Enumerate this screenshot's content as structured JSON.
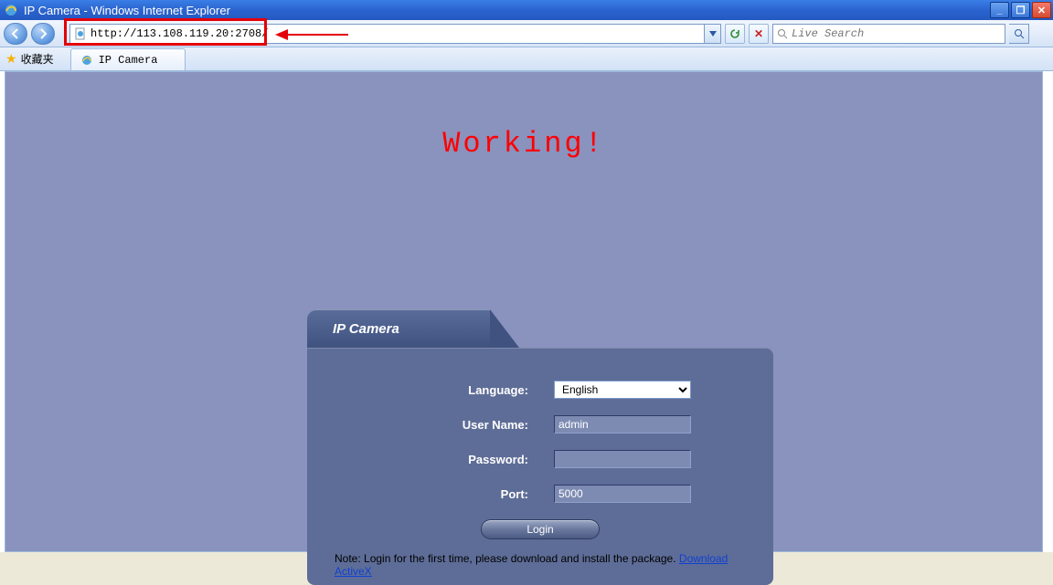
{
  "window": {
    "title": "IP Camera - Windows Internet Explorer"
  },
  "nav": {
    "url": "http://113.108.119.20:2708/",
    "search_placeholder": "Live Search"
  },
  "favorites": {
    "label": "收藏夹"
  },
  "tab": {
    "title": "IP Camera"
  },
  "page": {
    "banner": "Working!",
    "panel_title": "IP Camera",
    "labels": {
      "language": "Language:",
      "username": "User Name:",
      "password": "Password:",
      "port": "Port:"
    },
    "values": {
      "language": "English",
      "username": "admin",
      "password": "",
      "port": "5000"
    },
    "login_label": "Login",
    "note_text": "Note: Login for the first time, please download and install the package.",
    "note_link": "Download ActiveX"
  }
}
